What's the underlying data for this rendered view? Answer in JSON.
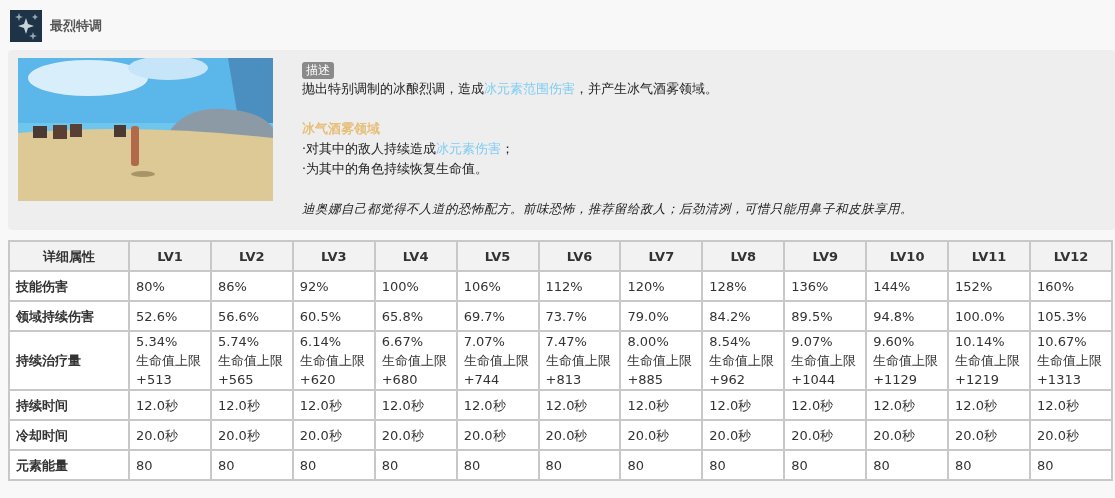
{
  "header": {
    "title": "最烈特调"
  },
  "description": {
    "tag": "描述",
    "lines": [
      {
        "kind": "text",
        "parts": [
          {
            "text": "抛出特别调制的冰酿烈调，造成",
            "highlight": false
          },
          {
            "text": "冰元素范围伤害",
            "highlight": true
          },
          {
            "text": "，并产生冰气酒雾领域。",
            "highlight": false
          }
        ]
      },
      {
        "kind": "gap"
      },
      {
        "kind": "heading",
        "parts": [
          {
            "text": "冰气酒雾领域"
          }
        ]
      },
      {
        "kind": "text",
        "parts": [
          {
            "text": "·对其中的敌人持续造成",
            "highlight": false
          },
          {
            "text": "冰元素伤害",
            "highlight": true
          },
          {
            "text": "；",
            "highlight": false
          }
        ]
      },
      {
        "kind": "text",
        "parts": [
          {
            "text": "·为其中的角色持续恢复生命值。"
          }
        ]
      },
      {
        "kind": "gap"
      },
      {
        "kind": "quote",
        "parts": [
          {
            "text": "迪奥娜自己都觉得不人道的恐怖配方。前味恐怖，推荐留给敌人；后劲清冽，可惜只能用鼻子和皮肤享用。"
          }
        ]
      }
    ]
  },
  "table": {
    "columns": [
      "详细属性",
      "LV1",
      "LV2",
      "LV3",
      "LV4",
      "LV5",
      "LV6",
      "LV7",
      "LV8",
      "LV9",
      "LV10",
      "LV11",
      "LV12"
    ],
    "rows": [
      [
        "技能伤害",
        "80%",
        "86%",
        "92%",
        "100%",
        "106%",
        "112%",
        "120%",
        "128%",
        "136%",
        "144%",
        "152%",
        "160%"
      ],
      [
        "领域持续伤害",
        "52.6%",
        "56.6%",
        "60.5%",
        "65.8%",
        "69.7%",
        "73.7%",
        "79.0%",
        "84.2%",
        "89.5%",
        "94.8%",
        "100.0%",
        "105.3%"
      ],
      [
        "持续治疗量",
        "5.34%\n生命值上限\n+513",
        "5.74%\n生命值上限\n+565",
        "6.14%\n生命值上限\n+620",
        "6.67%\n生命值上限\n+680",
        "7.07%\n生命值上限\n+744",
        "7.47%\n生命值上限\n+813",
        "8.00%\n生命值上限\n+885",
        "8.54%\n生命值上限\n+962",
        "9.07%\n生命值上限\n+1044",
        "9.60%\n生命值上限\n+1129",
        "10.14%\n生命值上限\n+1219",
        "10.67%\n生命值上限\n+1313"
      ],
      [
        "持续时间",
        "12.0秒",
        "12.0秒",
        "12.0秒",
        "12.0秒",
        "12.0秒",
        "12.0秒",
        "12.0秒",
        "12.0秒",
        "12.0秒",
        "12.0秒",
        "12.0秒",
        "12.0秒"
      ],
      [
        "冷却时间",
        "20.0秒",
        "20.0秒",
        "20.0秒",
        "20.0秒",
        "20.0秒",
        "20.0秒",
        "20.0秒",
        "20.0秒",
        "20.0秒",
        "20.0秒",
        "20.0秒",
        "20.0秒"
      ],
      [
        "元素能量",
        "80",
        "80",
        "80",
        "80",
        "80",
        "80",
        "80",
        "80",
        "80",
        "80",
        "80",
        "80"
      ]
    ]
  }
}
